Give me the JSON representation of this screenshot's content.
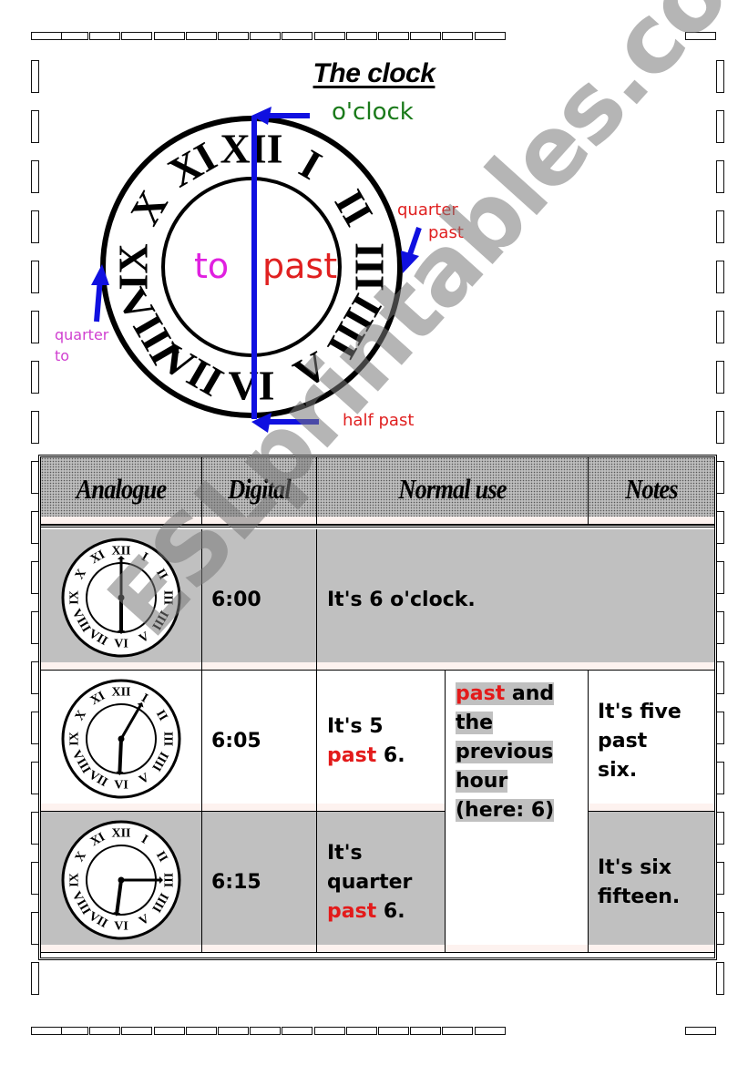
{
  "title": "The clock",
  "diagram": {
    "center_left": "to",
    "center_right": "past",
    "labels": {
      "oclock": "o'clock",
      "quarter_past_1": "quarter",
      "quarter_past_2": "past",
      "quarter_to_1": "quarter",
      "quarter_to_2": "to",
      "half_past": "half past"
    },
    "numerals": [
      "XII",
      "I",
      "II",
      "III",
      "IIII",
      "V",
      "VI",
      "VII",
      "VIII",
      "IX",
      "X",
      "XI"
    ],
    "colors": {
      "arrow": "#1010e0",
      "to": "#e020e0",
      "past": "#e02020",
      "oclock": "#1a7a1a"
    }
  },
  "table": {
    "headers": [
      "Analogue",
      "Digital",
      "Normal use",
      "Notes"
    ],
    "rows": [
      {
        "time": "6:00",
        "hour": 6,
        "minute": 0,
        "normal": "It's 6 o'clock.",
        "note": ""
      },
      {
        "time": "6:05",
        "hour": 6,
        "minute": 5,
        "normal_a": "It's 5",
        "normal_past": "past",
        "normal_b": "6.",
        "note_lines": [
          "It's five",
          "past",
          "six."
        ]
      },
      {
        "time": "6:15",
        "hour": 6,
        "minute": 15,
        "normal_a1": "It's",
        "normal_a2": "quarter",
        "normal_past": "past",
        "normal_b": "6.",
        "note_lines": [
          "It's six",
          "fifteen."
        ]
      }
    ],
    "rule": {
      "past": "past",
      "line1_rest": "and",
      "line2": "the",
      "line3": "previous",
      "line4": "hour",
      "line5": "(here: 6)"
    }
  },
  "watermark": "ESLprintables.com"
}
